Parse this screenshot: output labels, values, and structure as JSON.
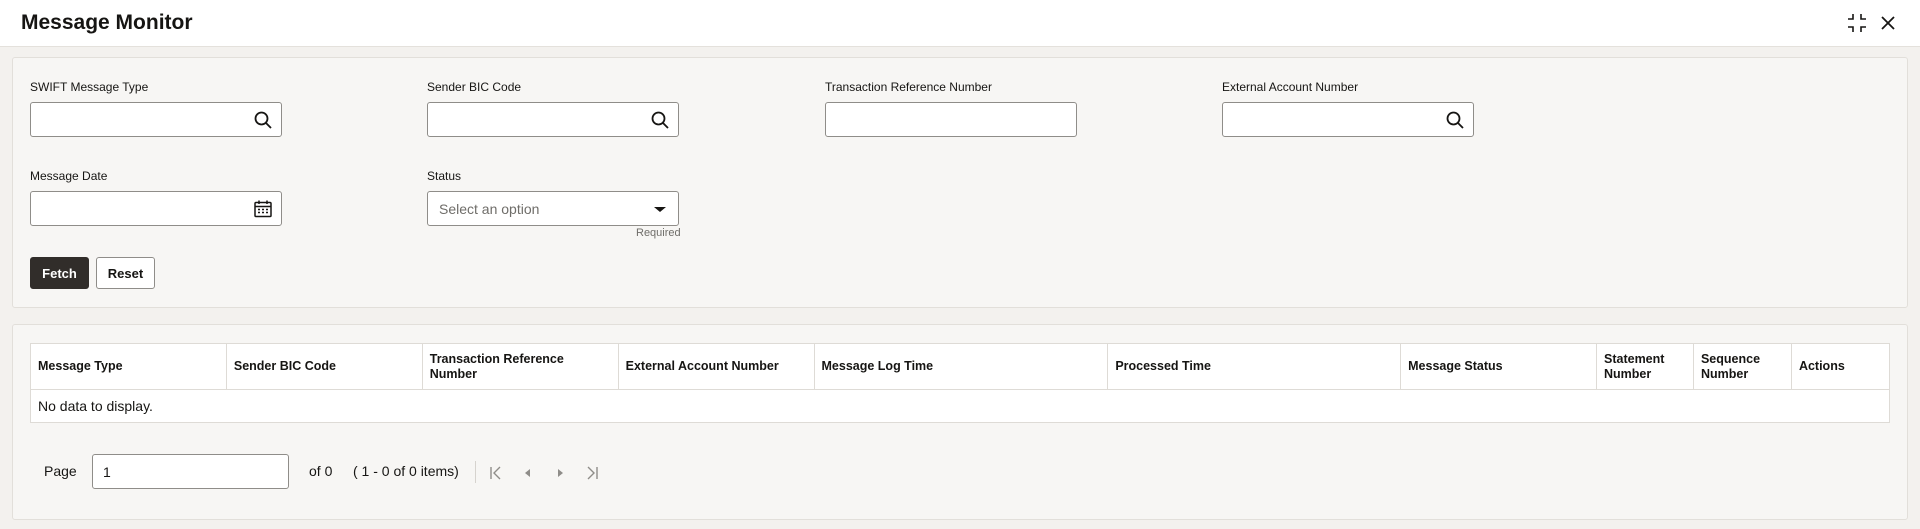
{
  "window": {
    "title": "Message Monitor",
    "icons": [
      "fullscreen-exit-icon",
      "close-icon"
    ]
  },
  "search": {
    "fields": {
      "swift_message_type": {
        "label": "SWIFT Message Type",
        "value": "",
        "icon": "search-icon"
      },
      "sender_bic_code": {
        "label": "Sender BIC Code",
        "value": "",
        "icon": "search-icon"
      },
      "transaction_reference_number": {
        "label": "Transaction Reference Number",
        "value": ""
      },
      "external_account_number": {
        "label": "External Account Number",
        "value": "",
        "icon": "search-icon"
      },
      "message_date": {
        "label": "Message Date",
        "value": "",
        "icon": "calendar-icon"
      },
      "status": {
        "label": "Status",
        "placeholder": "Select an option",
        "helper": "Required",
        "icon": "chevron-down-icon"
      }
    },
    "buttons": {
      "fetch": "Fetch",
      "reset": "Reset"
    }
  },
  "grid": {
    "columns": [
      "Message Type",
      "Sender BIC Code",
      "Transaction Reference Number",
      "External Account Number",
      "Message Log Time",
      "Processed Time",
      "Message Status",
      "Statement Number",
      "Sequence Number",
      "Actions"
    ],
    "empty_text": "No data to display.",
    "rows": []
  },
  "pagination": {
    "page_label": "Page",
    "page_value": "1",
    "of_text": "of 0",
    "items_text": "( 1 - 0 of 0 items)"
  },
  "colors": {
    "primary_button": "#312d2a",
    "panel_background": "#f7f6f4",
    "page_background": "#f3f1ee"
  }
}
